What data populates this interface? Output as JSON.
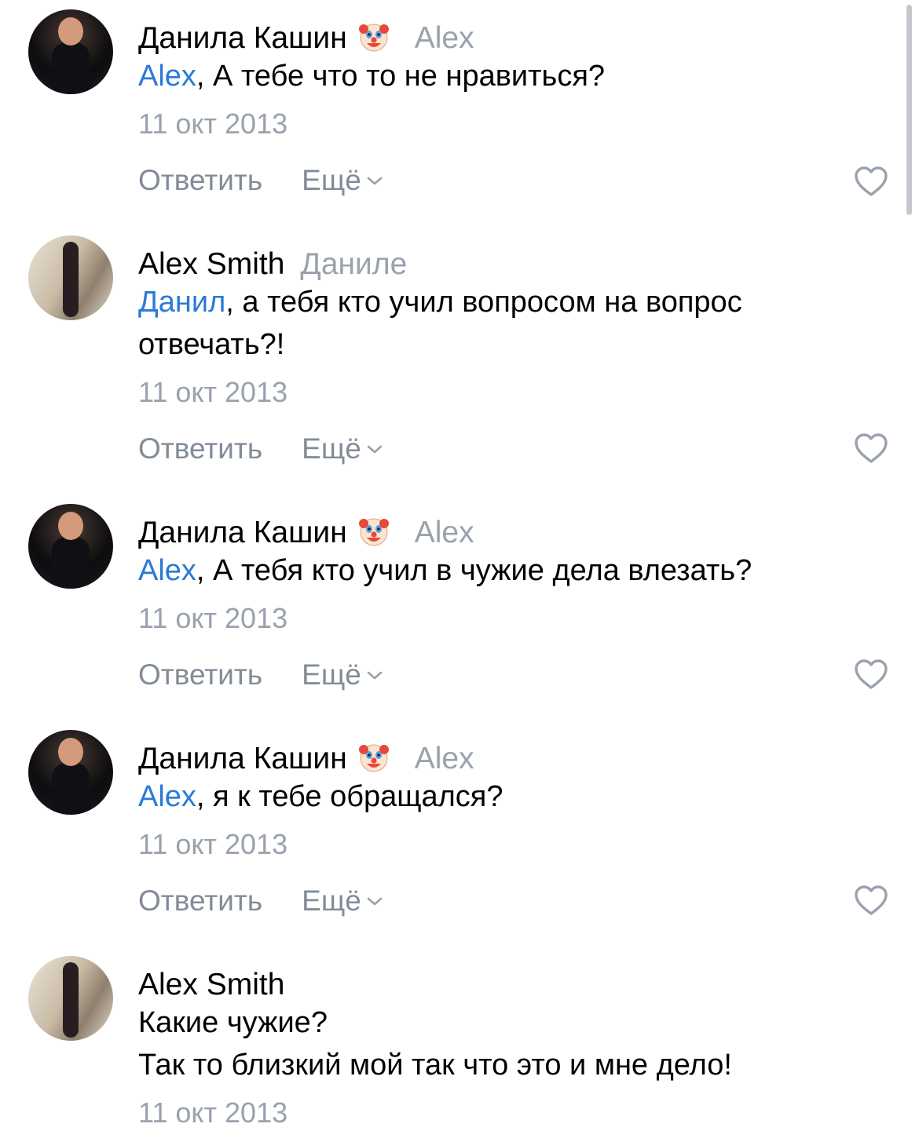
{
  "comments": [
    {
      "author": "Данила Кашин",
      "has_emoji": true,
      "reply_to": "Alex",
      "mention": "Alex",
      "text_lines": [
        ", А тебе что то не нравиться?"
      ],
      "date": "11 окт 2013",
      "reply_label": "Ответить",
      "more_label": "Ещё"
    },
    {
      "author": "Alex Smith",
      "has_emoji": false,
      "reply_to": "Даниле",
      "mention": "Данил",
      "text_lines": [
        ", а тебя кто учил вопросом на вопрос",
        "отвечать?!"
      ],
      "date": "11 окт 2013",
      "reply_label": "Ответить",
      "more_label": "Ещё"
    },
    {
      "author": "Данила Кашин",
      "has_emoji": true,
      "reply_to": "Alex",
      "mention": "Alex",
      "text_lines": [
        ", А тебя кто учил в чужие дела влезать?"
      ],
      "date": "11 окт 2013",
      "reply_label": "Ответить",
      "more_label": "Ещё"
    },
    {
      "author": "Данила Кашин",
      "has_emoji": true,
      "reply_to": "Alex",
      "mention": "Alex",
      "text_lines": [
        ", я к тебе обращался?"
      ],
      "date": "11 окт 2013",
      "reply_label": "Ответить",
      "more_label": "Ещё"
    },
    {
      "author": "Alex Smith",
      "has_emoji": false,
      "reply_to": "",
      "mention": "",
      "text_lines": [
        "Какие чужие?",
        "Так то близкий мой так что это и мне дело!"
      ],
      "date": "11 окт 2013"
    }
  ],
  "icons": {
    "author_badge": "clown-face-emoji",
    "like": "heart-outline-icon",
    "more": "chevron-down-icon"
  },
  "colors": {
    "mention": "#2a7ad6",
    "secondary": "#99a2ad",
    "action": "#818c99"
  }
}
